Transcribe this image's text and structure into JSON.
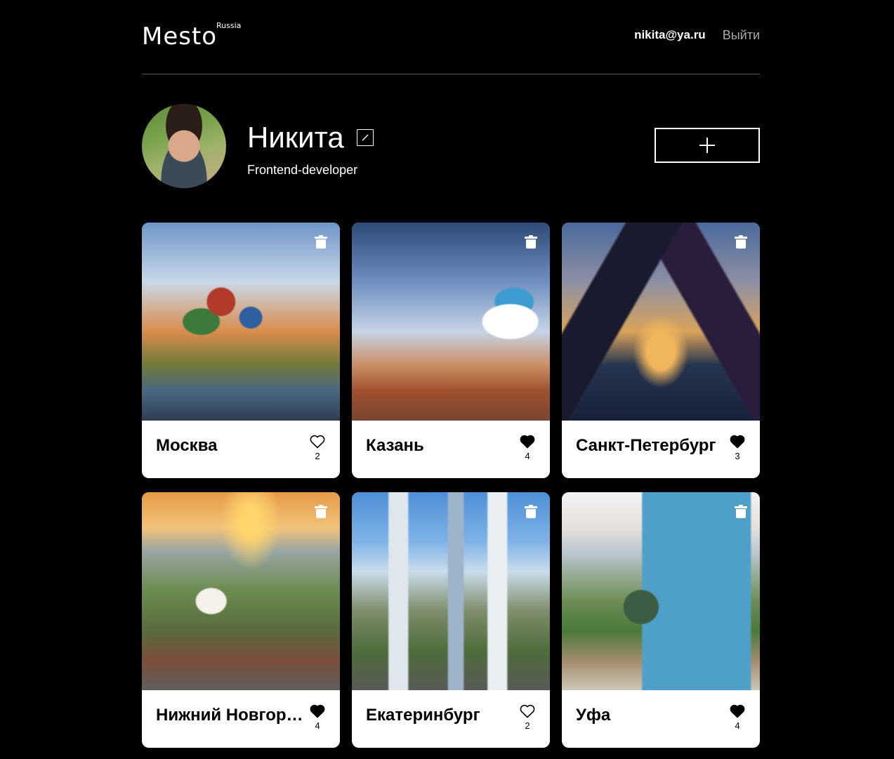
{
  "header": {
    "logo": "Mesto",
    "logo_sub": "Russia",
    "email": "nikita@ya.ru",
    "logout_label": "Выйти"
  },
  "profile": {
    "name": "Никита",
    "about": "Frontend-developer",
    "add_label": "+"
  },
  "cards": [
    {
      "title": "Москва",
      "likes": "2",
      "liked": false
    },
    {
      "title": "Казань",
      "likes": "4",
      "liked": true
    },
    {
      "title": "Санкт-Петербург",
      "likes": "3",
      "liked": true
    },
    {
      "title": "Нижний Новгород",
      "likes": "4",
      "liked": true
    },
    {
      "title": "Екатеринбург",
      "likes": "2",
      "liked": false
    },
    {
      "title": "Уфа",
      "likes": "4",
      "liked": true
    }
  ]
}
